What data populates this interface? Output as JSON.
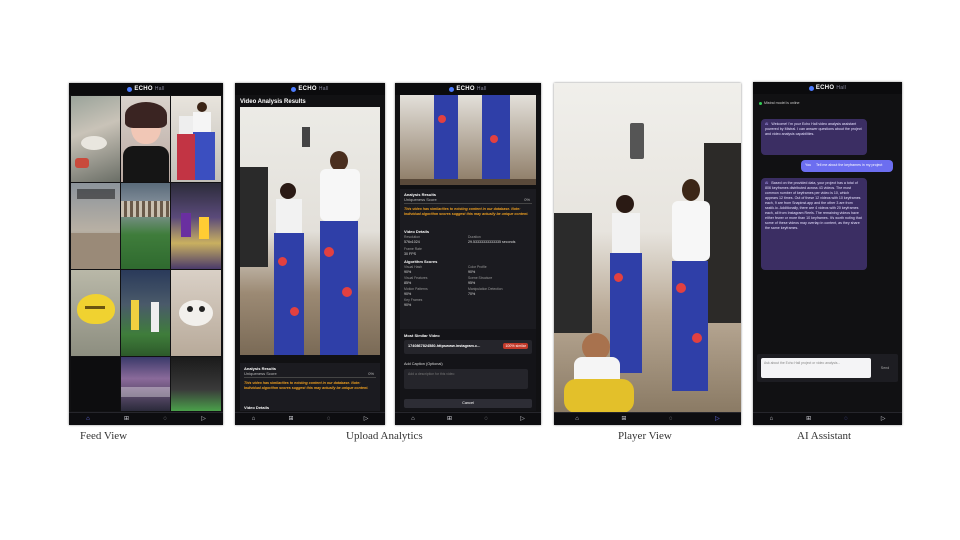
{
  "captions": [
    "Feed View",
    "Upload Analytics",
    "Player View",
    "AI Assistant"
  ],
  "brand": {
    "name": "ECHO",
    "suffix": "Hall"
  },
  "nav_icons": [
    "home-icon",
    "plus-square-icon",
    "chat-bubble-icon",
    "play-icon"
  ],
  "upload": {
    "title": "Video Analysis Results",
    "results_heading": "Analysis Results",
    "uniqueness_label": "Uniqueness Score",
    "uniqueness_value": "0%",
    "warning": "This video has similarities to existing content in our database. Note: Individual algorithm scores suggest this may actually be unique content.",
    "details_heading": "Video Details",
    "resolution_label": "Resolution",
    "resolution_value": "576x1024",
    "duration_label": "Duration",
    "duration_value": "29.53333333333335 seconds",
    "frame_rate_label": "Frame Rate",
    "frame_rate_value": "30 FPS",
    "algo_heading": "Algorithm Scores",
    "algorithms": [
      {
        "name": "Visual Hash",
        "value": "90%"
      },
      {
        "name": "Color Profile",
        "value": "90%"
      },
      {
        "name": "Visual Features",
        "value": "85%"
      },
      {
        "name": "Scene Structure",
        "value": "95%"
      },
      {
        "name": "Motion Patterns",
        "value": "90%"
      },
      {
        "name": "Manipulation Detection",
        "value": "70%"
      },
      {
        "name": "Key Frames",
        "value": "90%"
      }
    ],
    "similar_heading": "Most Similar Video",
    "similar_name": "1740867824580-httpswww.instagram.c...",
    "similar_badge": "100% similar",
    "caption_label": "Add Caption (Optional)",
    "caption_placeholder": "Add a description for this video",
    "cancel_label": "Cancel",
    "results_heading_2": "Analysis Results",
    "uniqueness_label_2": "Uniqueness Score",
    "uniqueness_value_2": "0%",
    "warning_2": "This video has similarities to existing content in our database. Note: Individual algorithm scores suggest this may actually be unique content.",
    "details_heading_2": "Video Details"
  },
  "assistant": {
    "status": "Mistral model is online",
    "welcome_avatar": "AI",
    "welcome": "Welcome! I'm your Echo Hall video analysis assistant powered by Mistral. I can answer questions about the project and video analysis capabilities.",
    "user_avatar": "You",
    "user_msg": "Tell me about the keyframes in my project",
    "reply_avatar": "AI",
    "reply": "Based on the provided data, your project has a total of 806 keyframes distributed across 43 videos. The most common number of keyframes per video is 10, which appears 12 times. Out of these 12 videos with 10 keyframes each, 9 are from Snapinst.app and the other 3 are from ssstik.io. Additionally, there are 4 videos with 20 keyframes each, all from Instagram Reels. The remaining videos have either fewer or more than 10 keyframes. It's worth noting that some of these videos may overlap in content, as they share the same keyframes.",
    "input_placeholder": "Ask about the Echo Hall project or video analysis...",
    "send_label": "Send"
  }
}
